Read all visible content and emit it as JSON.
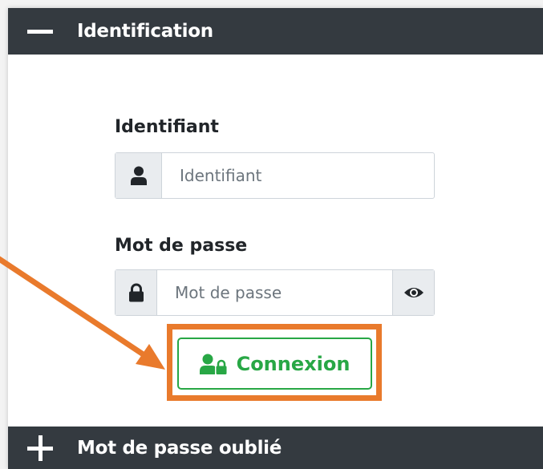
{
  "panels": {
    "identification": {
      "title": "Identification",
      "expanded": true
    },
    "forgot": {
      "title": "Mot de passe oublié",
      "expanded": false
    }
  },
  "form": {
    "username": {
      "label": "Identifiant",
      "placeholder": "Identifiant",
      "value": ""
    },
    "password": {
      "label": "Mot de passe",
      "placeholder": "Mot de passe",
      "value": ""
    },
    "submit_label": "Connexion"
  },
  "colors": {
    "header_bg": "#343a40",
    "success": "#28a745",
    "annotation": "#e97a2c"
  },
  "icons": {
    "collapse": "minus-icon",
    "expand": "plus-icon",
    "username": "user-icon",
    "password": "lock-icon",
    "toggle_password": "eye-icon",
    "submit": "user-lock-icon"
  }
}
